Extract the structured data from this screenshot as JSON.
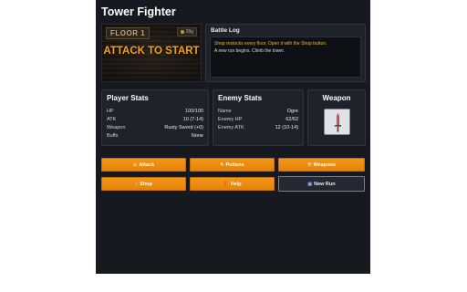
{
  "app": {
    "title": "Tower Fighter"
  },
  "scene": {
    "floor_label": "FLOOR 1",
    "gold": "28g",
    "prompt": "ATTACK TO START"
  },
  "battle_log": {
    "title": "Battle Log",
    "lines": [
      "Shop restocks every floor. Open it with the Shop button.",
      "A new run begins. Climb the tower."
    ]
  },
  "player": {
    "title": "Player Stats",
    "hp_label": "HP",
    "hp": "100/100",
    "atk_label": "ATK",
    "atk": "10 (7-14)",
    "weapon_label": "Weapon",
    "weapon": "Rusty Sword (+0)",
    "buffs_label": "Buffs",
    "buffs": "None"
  },
  "enemy": {
    "title": "Enemy Stats",
    "name_label": "Name",
    "name": "Ogre",
    "hp_label": "Enemy HP",
    "hp": "62/62",
    "atk_label": "Enemy ATK",
    "atk": "12 (10-14)"
  },
  "weapon_panel": {
    "title": "Weapon",
    "icon": "sword-icon"
  },
  "actions": {
    "attack": "Attack",
    "potions": "Potions",
    "weapons": "Weapons",
    "shop": "Shop",
    "help": "Help",
    "new_run": "New Run"
  },
  "colors": {
    "accent": "#f49418",
    "log_hint": "#f0b43c",
    "panel": "#1d222b",
    "background": "#161a20"
  }
}
